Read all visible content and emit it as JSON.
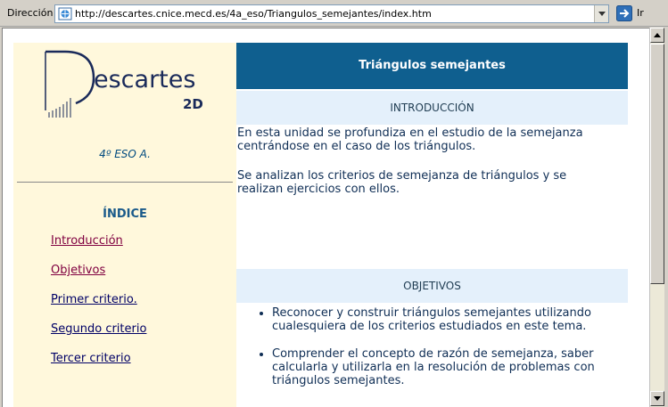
{
  "address_bar": {
    "label": "Dirección",
    "url": "http://descartes.cnice.mecd.es/4a_eso/Triangulos_semejantes/index.htm",
    "go_label": "Ir"
  },
  "sidebar": {
    "logo_text": "Descartes",
    "logo_badge": "2D",
    "course": "4º ESO A.",
    "indice_title": "ÍNDICE",
    "links": [
      {
        "label": "Introducción",
        "color": "#800040"
      },
      {
        "label": "Objetivos",
        "color": "#800040"
      },
      {
        "label": "Primer criterio.",
        "color": "#000066"
      },
      {
        "label": "Segundo criterio",
        "color": "#000066"
      },
      {
        "label": "Tercer criterio",
        "color": "#000066"
      }
    ]
  },
  "main": {
    "title": "Triángulos semejantes",
    "intro_heading": "INTRODUCCIÓN",
    "intro_p1": "En esta unidad se profundiza en el estudio de la semejanza centrándose en el caso de los triángulos.",
    "intro_p2": "Se analizan los criterios de semejanza de triángulos y se realizan ejercicios con ellos.",
    "objetivos_heading": "OBJETIVOS",
    "objetivos": [
      "Reconocer y construir triángulos semejantes utilizando cualesquiera de los criterios estudiados en este tema.",
      "Comprender el concepto de razón de semejanza, saber calcularla y utilizarla en la resolución de problemas con triángulos semejantes."
    ]
  },
  "colors": {
    "title_bar": "#0f5f8f",
    "section_head": "#e4f0fb",
    "sidebar_bg": "#fff8dc",
    "visited_link": "#800040",
    "link": "#000066"
  }
}
